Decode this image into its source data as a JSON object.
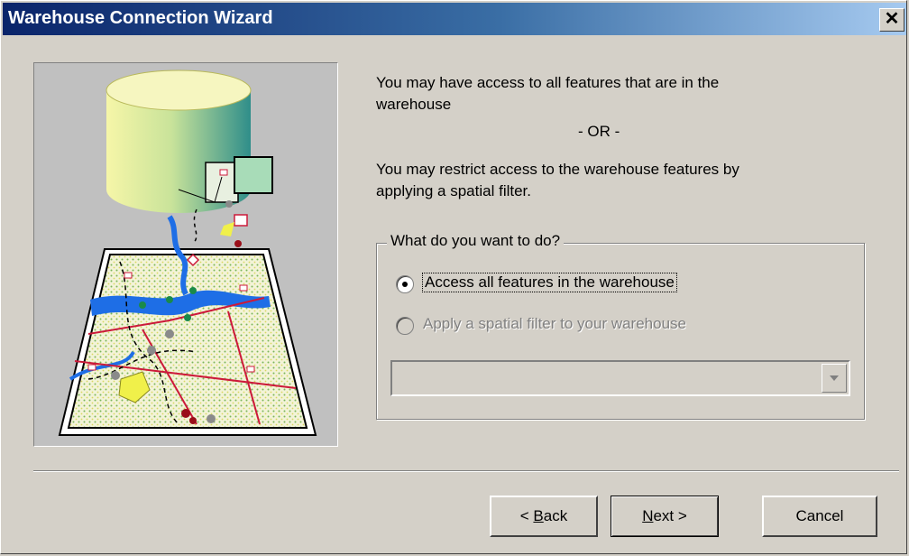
{
  "window": {
    "title": "Warehouse Connection Wizard",
    "close_glyph": "✕"
  },
  "description": {
    "line1": "You may have access to all features that are in the",
    "line2": "warehouse",
    "or_text": "- OR -",
    "line3": "You may restrict access to the warehouse features by",
    "line4": "applying a spatial filter."
  },
  "group": {
    "legend": "What do you want to do?",
    "options": [
      {
        "label": "Access all features in the warehouse",
        "selected": true,
        "enabled": true
      },
      {
        "label": "Apply a spatial filter to your warehouse",
        "selected": false,
        "enabled": false
      }
    ],
    "combo_value": ""
  },
  "buttons": {
    "back_prefix": "< ",
    "back_mnemonic": "B",
    "back_rest": "ack",
    "next_mnemonic": "N",
    "next_rest": "ext >",
    "cancel": "Cancel"
  },
  "icons": {
    "illustration": "database-to-map-illustration",
    "close": "close-icon",
    "dropdown": "chevron-down-icon"
  },
  "colors": {
    "titlebar_start": "#0a246a",
    "titlebar_end": "#a6caf0",
    "dialog_bg": "#d4d0c8"
  }
}
